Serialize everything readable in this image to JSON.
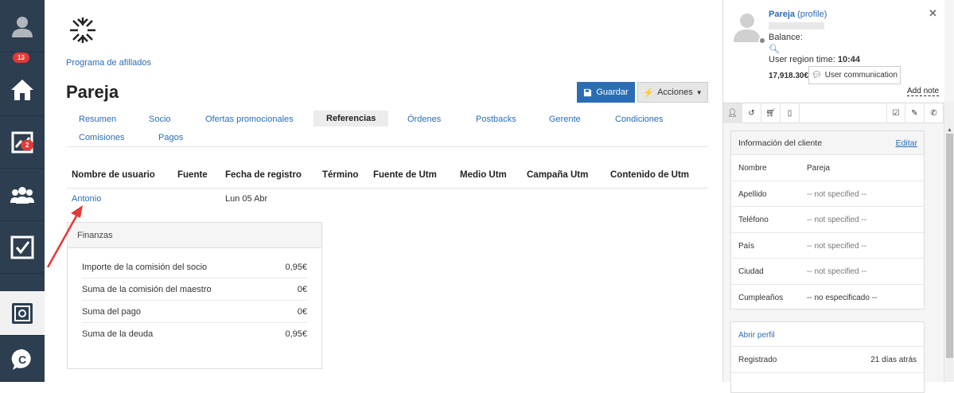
{
  "nav": {
    "badge_profile": "13",
    "badge_chart": "2",
    "items": [
      "user-avatar",
      "home-icon",
      "chart-icon",
      "users-icon",
      "tasks-icon",
      "mail-icon",
      "safe-icon",
      "chat-icon"
    ]
  },
  "breadcrumb": "Programa de afillados",
  "title": "Pareja",
  "buttons": {
    "save": "Guardar",
    "actions": "Acciones"
  },
  "tabs": [
    "Resumen",
    "Socio",
    "Ofertas promocionales",
    "Referencias",
    "Órdenes",
    "Postbacks",
    "Gerente",
    "Condiciones",
    "Comisiones",
    "Pagos"
  ],
  "active_tab": "Referencias",
  "table": {
    "headers": [
      "Nombre de usuario",
      "Fuente",
      "Fecha de registro",
      "Término",
      "Fuente de Utm",
      "Medio Utm",
      "Campaña Utm",
      "Contenido de Utm"
    ],
    "rows": [
      {
        "username": "Antonio",
        "fecha": "Lun 05 Abr"
      }
    ]
  },
  "finance": {
    "title": "Finanzas",
    "rows": [
      {
        "label": "Importe de la comisión del socio",
        "value": "0,95€"
      },
      {
        "label": "Suma de la comisión del maestro",
        "value": "0€"
      },
      {
        "label": "Suma del pago",
        "value": "0€"
      },
      {
        "label": "Suma de la deuda",
        "value": "0,95€"
      }
    ]
  },
  "right": {
    "name": "Pareja",
    "profile_link": "(profile)",
    "balance_label": "Balance:",
    "time_label": "User region time:",
    "time_value": "10:44",
    "amount": "17,918.30€",
    "user_comm": "User communication",
    "add_note": "Add note",
    "client_card": {
      "title": "Información del cliente",
      "edit": "Editar",
      "rows": [
        {
          "k": "Nombre",
          "v": "Pareja"
        },
        {
          "k": "Apellido",
          "v": "-- not specified --"
        },
        {
          "k": "Teléfono",
          "v": "-- not specified --"
        },
        {
          "k": "País",
          "v": "-- not specified --"
        },
        {
          "k": "Ciudad",
          "v": "-- not specified --"
        },
        {
          "k": "Cumpleaños",
          "v": "-- no especificado --"
        }
      ]
    },
    "profile_card": {
      "title": "Abrir perfil",
      "rows": [
        {
          "k": "Registrado",
          "v": "21 días atrás"
        }
      ]
    }
  },
  "colors": {
    "accent": "#2a6db4",
    "sidebar": "#2c3e50",
    "badge": "#e53935",
    "arrow": "#e53935"
  }
}
